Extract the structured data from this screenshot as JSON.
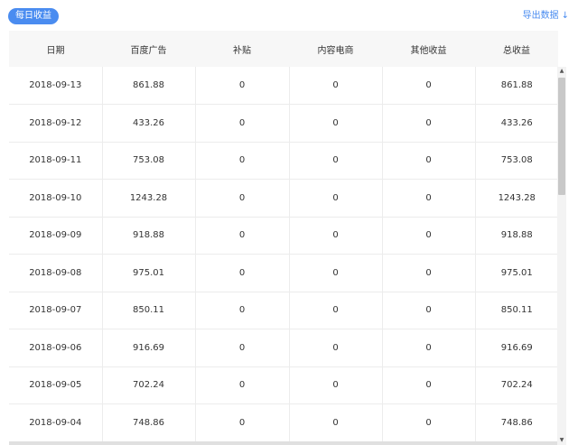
{
  "header": {
    "badge_label": "每日收益",
    "export_label": "导出数据",
    "export_icon": "download-arrow-icon"
  },
  "table": {
    "columns": [
      "日期",
      "百度广告",
      "补贴",
      "内容电商",
      "其他收益",
      "总收益"
    ],
    "rows": [
      [
        "2018-09-13",
        "861.88",
        "0",
        "0",
        "0",
        "861.88"
      ],
      [
        "2018-09-12",
        "433.26",
        "0",
        "0",
        "0",
        "433.26"
      ],
      [
        "2018-09-11",
        "753.08",
        "0",
        "0",
        "0",
        "753.08"
      ],
      [
        "2018-09-10",
        "1243.28",
        "0",
        "0",
        "0",
        "1243.28"
      ],
      [
        "2018-09-09",
        "918.88",
        "0",
        "0",
        "0",
        "918.88"
      ],
      [
        "2018-09-08",
        "975.01",
        "0",
        "0",
        "0",
        "975.01"
      ],
      [
        "2018-09-07",
        "850.11",
        "0",
        "0",
        "0",
        "850.11"
      ],
      [
        "2018-09-06",
        "916.69",
        "0",
        "0",
        "0",
        "916.69"
      ],
      [
        "2018-09-05",
        "702.24",
        "0",
        "0",
        "0",
        "702.24"
      ],
      [
        "2018-09-04",
        "748.86",
        "0",
        "0",
        "0",
        "748.86"
      ]
    ]
  },
  "colors": {
    "accent": "#4a8cf0",
    "header_bg": "#f7f7f7",
    "border": "#ececec"
  }
}
